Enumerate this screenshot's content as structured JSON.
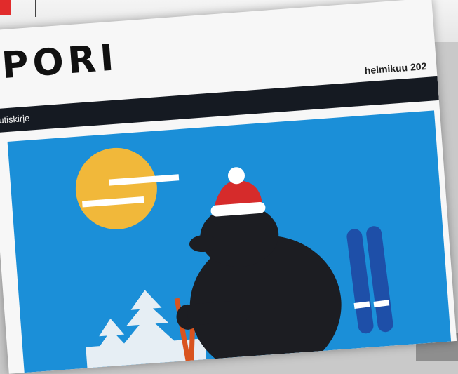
{
  "newsletter": {
    "brand": "PORI",
    "date": "helmikuu 202",
    "nav_label": "utiskirje"
  },
  "colors": {
    "sky": "#1b8fd8",
    "sun": "#f1b83a",
    "bear": "#1c1d22",
    "hat_red": "#d62b2b",
    "skis": "#1e4fa8",
    "poles": "#d9541f",
    "trees": "#e6eef4",
    "nav_bg": "#151a22"
  },
  "icons": [
    "sun-icon",
    "bear-icon",
    "santa-hat-icon",
    "skis-icon",
    "ski-poles-icon",
    "tree-icon"
  ]
}
